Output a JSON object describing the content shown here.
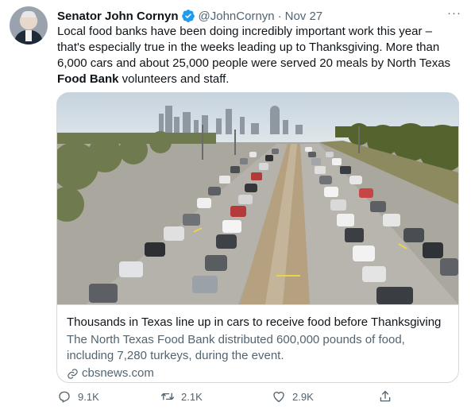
{
  "author": {
    "name": "Senator John Cornyn",
    "handle": "@JohnCornyn",
    "separator": "·",
    "date": "Nov 27",
    "verified": true
  },
  "more_label": "···",
  "tweet": {
    "line1": "Local food banks have been doing incredibly important work this year –",
    "line2": " that's especially true in the weeks leading up to Thanksgiving. More than",
    "line3": "6,000 cars and about 25,000 people were served 20 meals by North Texas",
    "line4_bold": "Food Bank",
    "line4_rest": " volunteers and staff."
  },
  "card": {
    "title": "Thousands in Texas line up in cars to receive food before Thanksgiving",
    "desc_line1": "The North Texas Food Bank distributed 600,000 pounds of food,",
    "desc_line2": "including 7,280 turkeys, during the event.",
    "domain": "cbsnews.com",
    "domain_icon": "link-icon"
  },
  "actions": {
    "reply_count": "9.1K",
    "retweet_count": "2.1K",
    "like_count": "2.9K"
  },
  "colors": {
    "text": "#0f1419",
    "secondary": "#536471",
    "verified": "#1d9bf0",
    "border": "#cfd9de"
  }
}
